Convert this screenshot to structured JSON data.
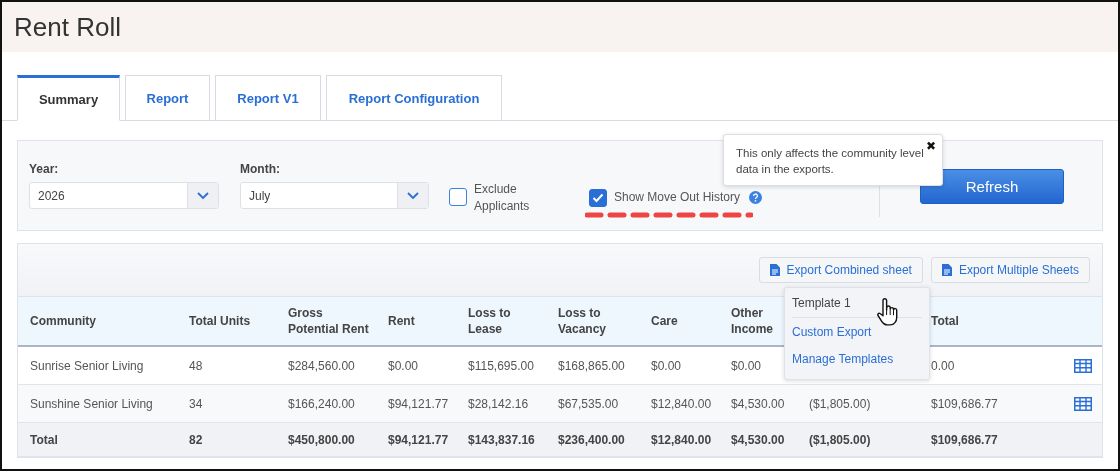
{
  "page": {
    "title": "Rent Roll"
  },
  "tabs": [
    {
      "label": "Summary",
      "selected": true
    },
    {
      "label": "Report",
      "selected": false
    },
    {
      "label": "Report V1",
      "selected": false
    },
    {
      "label": "Report Configuration",
      "selected": false
    }
  ],
  "filters": {
    "year": {
      "label": "Year:",
      "value": "2026"
    },
    "month": {
      "label": "Month:",
      "value": "July"
    },
    "options": [
      {
        "label": "Exclude Applicants",
        "checked": false,
        "help": false
      },
      {
        "label": "Show Move Out History",
        "checked": true,
        "help": true
      }
    ],
    "refresh_button": "Refresh"
  },
  "tooltip": {
    "text": "This only affects the community level data in the exports.",
    "close": "✖"
  },
  "export_buttons": [
    "Export Combined sheet",
    "Export Multiple Sheets"
  ],
  "export_menu": [
    {
      "label": "Template 1",
      "selected": true
    },
    {
      "label": "Custom Export",
      "selected": false
    },
    {
      "label": "Manage Templates",
      "selected": false
    }
  ],
  "table": {
    "columns": [
      "Community",
      "Total Units",
      "Gross Potential Rent",
      "Rent",
      "Loss to Lease",
      "Loss to Vacancy",
      "Care",
      "Other Income",
      null,
      "Total"
    ],
    "rows": [
      {
        "kind": "data",
        "cells": [
          "Sunrise Senior Living",
          "48",
          "$284,560.00",
          "$0.00",
          "$115,695.00",
          "$168,865.00",
          "$0.00",
          "$0.00",
          null,
          "0.00"
        ]
      },
      {
        "kind": "data",
        "cells": [
          "Sunshine Senior Living",
          "34",
          "$166,240.00",
          "$94,121.77",
          "$28,142.16",
          "$67,535.00",
          "$12,840.00",
          "$4,530.00",
          "($1,805.00)",
          "$109,686.77"
        ]
      },
      {
        "kind": "total",
        "cells": [
          "Total",
          "82",
          "$450,800.00",
          "$94,121.77",
          "$143,837.16",
          "$236,400.00",
          "$12,840.00",
          "$4,530.00",
          "($1,805.00)",
          "$109,686.77"
        ]
      }
    ]
  }
}
